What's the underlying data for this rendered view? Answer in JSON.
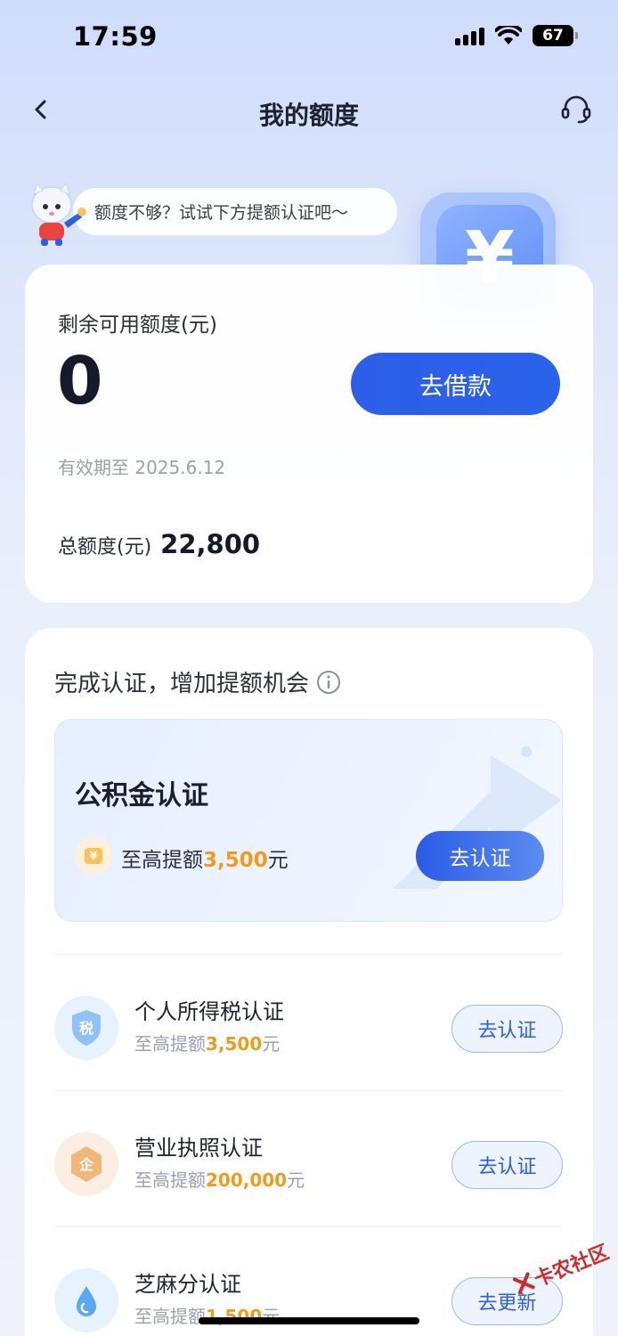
{
  "status_bar": {
    "time": "17:59",
    "battery": "67"
  },
  "nav": {
    "title": "我的额度"
  },
  "tip": {
    "text": "额度不够？试试下方提额认证吧～"
  },
  "quota": {
    "available_label": "剩余可用额度(元)",
    "available_value": "0",
    "borrow_label": "去借款",
    "expiry": "有效期至 2025.6.12",
    "total_label": "总额度(元)",
    "total_value": "22,800"
  },
  "auth": {
    "heading": "完成认证，增加提额机会",
    "featured": {
      "title": "公积金认证",
      "prefix": "至高提额",
      "amount": "3,500",
      "suffix": "元",
      "button": "去认证"
    },
    "items": [
      {
        "title": "个人所得税认证",
        "prefix": "至高提额",
        "amount": "3,500",
        "suffix": "元",
        "button": "去认证",
        "icon": "tax-icon",
        "icon_text": "税"
      },
      {
        "title": "营业执照认证",
        "prefix": "至高提额",
        "amount": "200,000",
        "suffix": "元",
        "button": "去认证",
        "icon": "business-license-icon",
        "icon_text": "企"
      },
      {
        "title": "芝麻分认证",
        "prefix": "至高提额",
        "amount": "1,500",
        "suffix": "元",
        "button": "去更新",
        "icon": "sesame-icon"
      }
    ]
  },
  "watermark": {
    "text": "卡农社区"
  },
  "colors": {
    "primary": "#2d5ee8",
    "amount": "#f29a1c"
  }
}
